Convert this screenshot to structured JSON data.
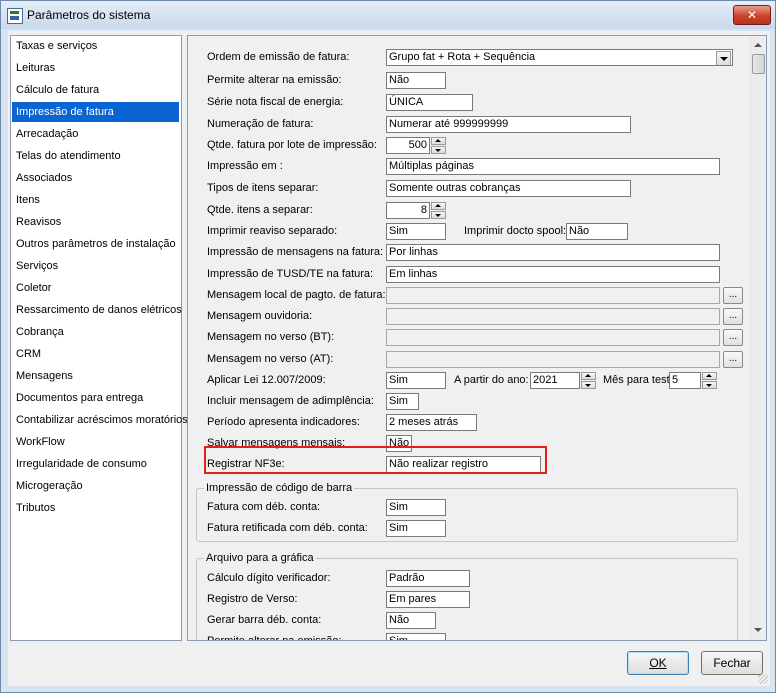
{
  "window": {
    "title": "Parâmetros do sistema",
    "close_label": "✕"
  },
  "sidebar": {
    "selected_index": 3,
    "items": [
      "Taxas e serviços",
      "Leituras",
      "Cálculo de fatura",
      "Impressão de fatura",
      "Arrecadação",
      "Telas do atendimento",
      "Associados",
      "Itens",
      "Reavisos",
      "Outros parâmetros de instalação",
      "Serviços",
      "Coletor",
      "Ressarcimento de danos elétricos",
      "Cobrança",
      "CRM",
      "Mensagens",
      "Documentos para entrega",
      "Contabilizar acréscimos moratórios",
      "WorkFlow",
      "Irregularidade de consumo",
      "Microgeração",
      "Tributos"
    ]
  },
  "form": {
    "ordem_emissao": {
      "label": "Ordem de emissão de fatura:",
      "value": "Grupo fat + Rota + Sequência"
    },
    "permite_alterar": {
      "label": "Permite alterar na emissão:",
      "value": "Não"
    },
    "serie_nota": {
      "label": "Série nota fiscal de energia:",
      "value": "ÚNICA"
    },
    "numeracao": {
      "label": "Numeração de fatura:",
      "value": "Numerar até 999999999"
    },
    "qtde_fatura": {
      "label": "Qtde. fatura por lote de impressão:",
      "value": "500"
    },
    "impressao_em": {
      "label": "Impressão em :",
      "value": "Múltiplas páginas"
    },
    "tipos_itens": {
      "label": "Tipos de itens separar:",
      "value": "Somente outras cobranças"
    },
    "qtde_itens": {
      "label": "Qtde. itens a separar:",
      "value": "8"
    },
    "imprimir_reaviso": {
      "label": "Imprimir reaviso separado:",
      "value": "Sim"
    },
    "imprimir_spool": {
      "label": "Imprimir docto spool:",
      "value": "Não"
    },
    "impressao_mensagens": {
      "label": "Impressão de mensagens na fatura:",
      "value": "Por linhas"
    },
    "impressao_tusd": {
      "label": "Impressão de TUSD/TE na fatura:",
      "value": "Em linhas"
    },
    "msg_local_pagto": {
      "label": "Mensagem local de pagto. de fatura:",
      "value": "",
      "button": "..."
    },
    "msg_ouvidoria": {
      "label": "Mensagem ouvidoria:",
      "value": "",
      "button": "..."
    },
    "msg_verso_bt": {
      "label": "Mensagem no verso (BT):",
      "value": "",
      "button": "..."
    },
    "msg_verso_at": {
      "label": "Mensagem no verso (AT):",
      "value": "",
      "button": "..."
    },
    "aplicar_lei": {
      "label": "Aplicar Lei 12.007/2009:",
      "value": "Sim"
    },
    "a_partir_ano": {
      "label": "A partir do ano:",
      "value": "2021"
    },
    "mes_teste": {
      "label": "Mês para test",
      "value": "5"
    },
    "incluir_adimplencia": {
      "label": "Incluir mensagem de adimplência:",
      "value": "Sim"
    },
    "periodo_indicadores": {
      "label": "Período apresenta indicadores:",
      "value": "2 meses atrás"
    },
    "salvar_mensagens": {
      "label": "Salvar mensagens mensais:",
      "value": "Não"
    },
    "registrar_nf3e": {
      "label": "Registrar NF3e:",
      "value": "Não realizar registro"
    }
  },
  "group_barcode": {
    "title": "Impressão de código de barra",
    "fatura_deb": {
      "label": "Fatura com déb. conta:",
      "value": "Sim"
    },
    "fatura_retificada": {
      "label": "Fatura retificada com déb. conta:",
      "value": "Sim"
    }
  },
  "group_grafica": {
    "title": "Arquivo para a gráfica",
    "calculo_digito": {
      "label": "Cálculo dígito verificador:",
      "value": "Padrão"
    },
    "registro_verso": {
      "label": "Registro de Verso:",
      "value": "Em pares"
    },
    "gerar_barra": {
      "label": "Gerar barra déb. conta:",
      "value": "Não"
    },
    "permite_alterar": {
      "label": "Permite alterar na emissão:",
      "value": "Sim"
    }
  },
  "buttons": {
    "ok": "OK",
    "fechar": "Fechar"
  },
  "colors": {
    "selection": "#0a64d2",
    "highlight_border": "#e3201c"
  }
}
